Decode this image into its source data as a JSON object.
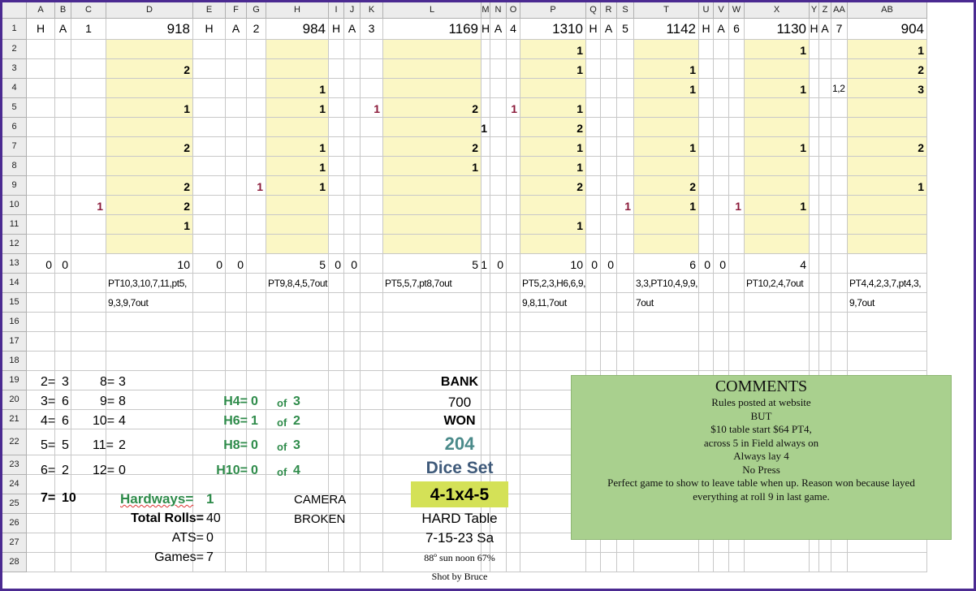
{
  "columns": [
    "A",
    "B",
    "C",
    "D",
    "E",
    "F",
    "G",
    "H",
    "I",
    "J",
    "K",
    "L",
    "M",
    "N",
    "O",
    "P",
    "Q",
    "R",
    "S",
    "T",
    "U",
    "V",
    "W",
    "X",
    "Y",
    "Z",
    "AA",
    "AB"
  ],
  "rows": [
    "1",
    "2",
    "3",
    "4",
    "5",
    "6",
    "7",
    "8",
    "9",
    "10",
    "11",
    "12",
    "13",
    "14",
    "15",
    "16",
    "17",
    "18",
    "19",
    "20",
    "21",
    "22",
    "23",
    "24",
    "25",
    "26",
    "27",
    "28"
  ],
  "cells": {
    "A1": "H",
    "B1": "A",
    "C1": "1",
    "D1": "918",
    "E1": "H",
    "F1": "A",
    "G1": "2",
    "H1": "984",
    "I1": "H",
    "J1": "A",
    "K1": "3",
    "L1": "1169",
    "M1": "H",
    "N1": "A",
    "O1": "4",
    "P1": "1310",
    "Q1": "H",
    "R1": "A",
    "S1": "5",
    "T1": "1142",
    "U1": "H",
    "V1": "A",
    "W1": "6",
    "X1": "1130",
    "Y1": "H",
    "Z1": "A",
    "AA1": "7",
    "AB1": "904",
    "P2": "1",
    "X2": "1",
    "AB2": "1",
    "D3": "2",
    "P3": "1",
    "T3": "1",
    "AB3": "2",
    "H4": "1",
    "T4": "1",
    "X4": "1",
    "AA4": "1,2",
    "AB4": "3",
    "D5": "1",
    "H5": "1",
    "K5": "1",
    "L5": "2",
    "O5": "1",
    "P5": "1",
    "M6": "1",
    "P6": "2",
    "D7": "2",
    "H7": "1",
    "L7": "2",
    "P7": "1",
    "T7": "1",
    "X7": "1",
    "AB7": "2",
    "H8": "1",
    "L8": "1",
    "P8": "1",
    "D9": "2",
    "G9": "1",
    "H9": "1",
    "P9": "2",
    "T9": "2",
    "AB9": "1",
    "C10": "1",
    "D10": "2",
    "S10": "1",
    "T10": "1",
    "W10": "1",
    "X10": "1",
    "D11": "1",
    "P11": "1",
    "A13": "0",
    "B13": "0",
    "D13": "10",
    "E13": "0",
    "F13": "0",
    "H13": "5",
    "I13": "0",
    "J13": "0",
    "L13": "5",
    "M13": "1",
    "N13": "0",
    "P13": "10",
    "Q13": "0",
    "R13": "0",
    "T13": "6",
    "U13": "0",
    "V13": "0",
    "X13": "4",
    "D14": "PT10,3,10,7,11,pt5,",
    "H14": "PT9,8,4,5,7out",
    "L14": "PT5,5,7,pt8,7out",
    "P14": "PT5,2,3,H6,6,9,",
    "T14": "3,3,PT10,4,9,9,",
    "X14": "PT10,2,4,7out",
    "AB14": "PT4,4,2,3,7,pt4,3,",
    "D15": "9,3,9,7out",
    "P15": "9,8,11,7out",
    "T15": "7out",
    "AB15": "9,7out"
  },
  "red_cells": [
    "C10",
    "G9",
    "K5",
    "O5",
    "S10",
    "W10"
  ],
  "yellow_cols": [
    "D",
    "H",
    "L",
    "P",
    "T",
    "X",
    "AB"
  ],
  "stats": {
    "r19": {
      "a": "2=",
      "b": "3",
      "c": "8=",
      "d": "3"
    },
    "r20": {
      "a": "3=",
      "b": "6",
      "c": "9=",
      "d": "8"
    },
    "r21": {
      "a": "4=",
      "b": "6",
      "c": "10=",
      "d": "4"
    },
    "r22": {
      "a": "5=",
      "b": "5",
      "c": "11=",
      "d": "2"
    },
    "r23": {
      "a": "6=",
      "b": "2",
      "c": "12=",
      "d": "0"
    },
    "r24": {
      "a": "7=",
      "b": "10"
    }
  },
  "hardways": {
    "h4": {
      "label": "H4=",
      "val": "0",
      "of": "of",
      "total": "3"
    },
    "h6": {
      "label": "H6=",
      "val": "1",
      "of": "of",
      "total": "2"
    },
    "h8": {
      "label": "H8=",
      "val": "0",
      "of": "of",
      "total": "3"
    },
    "h10": {
      "label": "H10=",
      "val": "0",
      "of": "of",
      "total": "4"
    },
    "hardways_label": "Hardways=",
    "hardways_val": "1"
  },
  "totals": {
    "total_rolls_label": "Total Rolls=",
    "total_rolls": "40",
    "ats_label": "ATS=",
    "ats": "0",
    "games_label": "Games=",
    "games": "7"
  },
  "camera": {
    "line1": "CAMERA",
    "line2": "BROKEN"
  },
  "bank": {
    "bank_label": "BANK",
    "bank_value": "700",
    "won_label": "WON",
    "won_value": "204",
    "dice_set_label": "Dice Set",
    "dice_set_value": "4-1x4-5",
    "table": "HARD Table",
    "date": "7-15-23 Sa",
    "weather": "88º sun noon 67%",
    "shot_by": "Shot by Bruce"
  },
  "comments": {
    "title": "COMMENTS",
    "lines": [
      "Rules posted at website",
      "BUT",
      "$10 table start $64 PT4,",
      "across 5 in Field always on",
      "Always lay 4",
      "No  Press",
      "Perfect game to show to leave table when up. Reason won because layed",
      "everything at roll 9 in last game."
    ]
  },
  "colors": {
    "yellow": "#fbf7c5",
    "red": "#8b1a3a",
    "green": "#2e8b4a",
    "teal": "#4a8a8a",
    "slate": "#3f5a7a",
    "lime": "#d4e157",
    "comment_bg": "#a9d08e",
    "frame": "#4b2a91"
  }
}
